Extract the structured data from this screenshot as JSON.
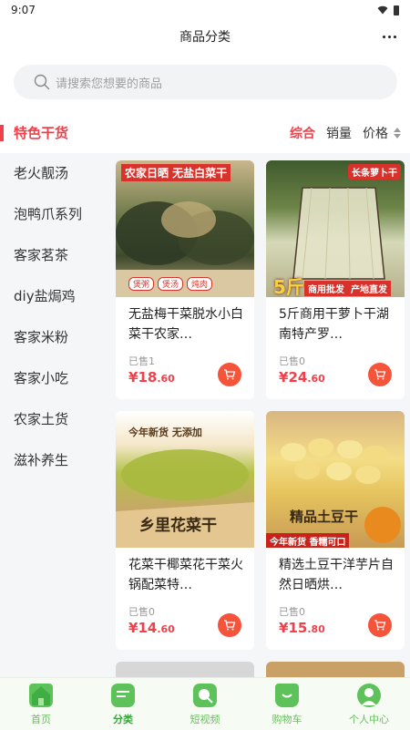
{
  "status": {
    "time": "9:07"
  },
  "header": {
    "title": "商品分类",
    "more_icon": "more-dots-icon"
  },
  "search": {
    "placeholder": "请搜索您想要的商品",
    "icon": "search-icon"
  },
  "category": {
    "title": "特色干货",
    "sorts": {
      "composite": "综合",
      "sales": "销量",
      "price": "价格"
    }
  },
  "sidebar": {
    "items": [
      {
        "label": "老火靓汤"
      },
      {
        "label": "泡鸭爪系列"
      },
      {
        "label": "客家茗茶"
      },
      {
        "label": "diy盐焗鸡"
      },
      {
        "label": "客家米粉"
      },
      {
        "label": "客家小吃"
      },
      {
        "label": "农家土货"
      },
      {
        "label": "滋补养生"
      }
    ]
  },
  "products": [
    {
      "name": "无盐梅干菜脱水小白菜干农家…",
      "sold": "已售1",
      "price_symbol": "¥",
      "price_int": "18",
      "price_dec": ".60",
      "img_banner": "农家日晒 无盐白菜干",
      "img_tags": [
        "煲粥",
        "煲汤",
        "炖肉"
      ]
    },
    {
      "name": "5斤商用干萝卜干湖南特产罗…",
      "sold": "已售0",
      "price_symbol": "¥",
      "price_int": "24",
      "price_dec": ".60",
      "img_banner": "长条萝卜干",
      "img_badge": "5斤",
      "img_footer": "商用批发  产地直发"
    },
    {
      "name": "花菜干椰菜花干菜火锅配菜特…",
      "sold": "已售0",
      "price_symbol": "¥",
      "price_int": "14",
      "price_dec": ".60",
      "img_banner": "今年新货 无添加",
      "img_footer": "乡里花菜干"
    },
    {
      "name": "精选土豆干洋芋片自然日晒烘…",
      "sold": "已售0",
      "price_symbol": "¥",
      "price_int": "15",
      "price_dec": ".80",
      "img_banner": "精品土豆干",
      "img_footer": "今年新货 香糯可口"
    }
  ],
  "tabbar": {
    "items": [
      {
        "label": "首页",
        "icon": "home-icon"
      },
      {
        "label": "分类",
        "icon": "category-icon",
        "active": true
      },
      {
        "label": "短视频",
        "icon": "video-icon"
      },
      {
        "label": "购物车",
        "icon": "cart-icon"
      },
      {
        "label": "个人中心",
        "icon": "profile-icon"
      }
    ]
  },
  "colors": {
    "accent": "#f0404a",
    "cart": "#f5533a",
    "tab_green": "#5ec25a"
  }
}
